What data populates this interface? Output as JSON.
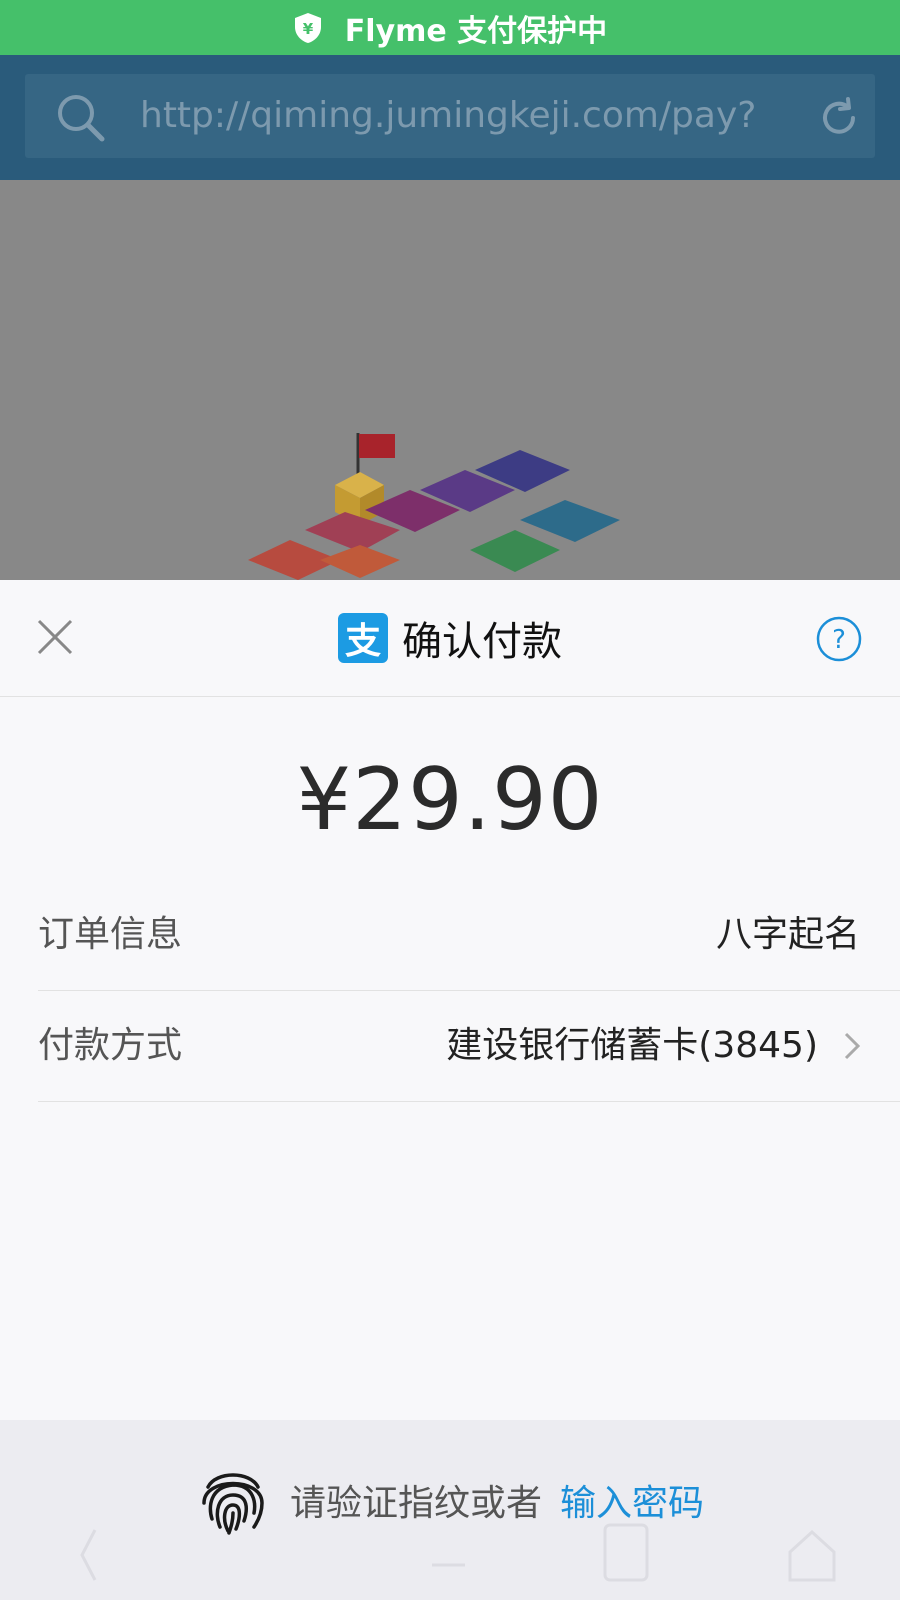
{
  "status_bar": {
    "text": "Flyme 支付保护中",
    "shield_symbol": "¥",
    "color": "#45c06a"
  },
  "browser": {
    "url": "http://qiming.jumingkeji.com/pay?",
    "search_icon": "search-icon",
    "reload_icon": "reload-icon"
  },
  "sheet": {
    "title": "确认付款",
    "logo_text": "支",
    "close_icon": "close-icon",
    "help_icon": "help-icon",
    "amount": "¥29.90",
    "order_label": "订单信息",
    "order_value": "八字起名",
    "method_label": "付款方式",
    "method_value": "建设银行储蓄卡(3845)",
    "accent_color": "#1c9be3"
  },
  "footer": {
    "prompt": "请验证指纹或者",
    "password_link": "输入密码",
    "fingerprint_icon": "fingerprint-icon"
  }
}
